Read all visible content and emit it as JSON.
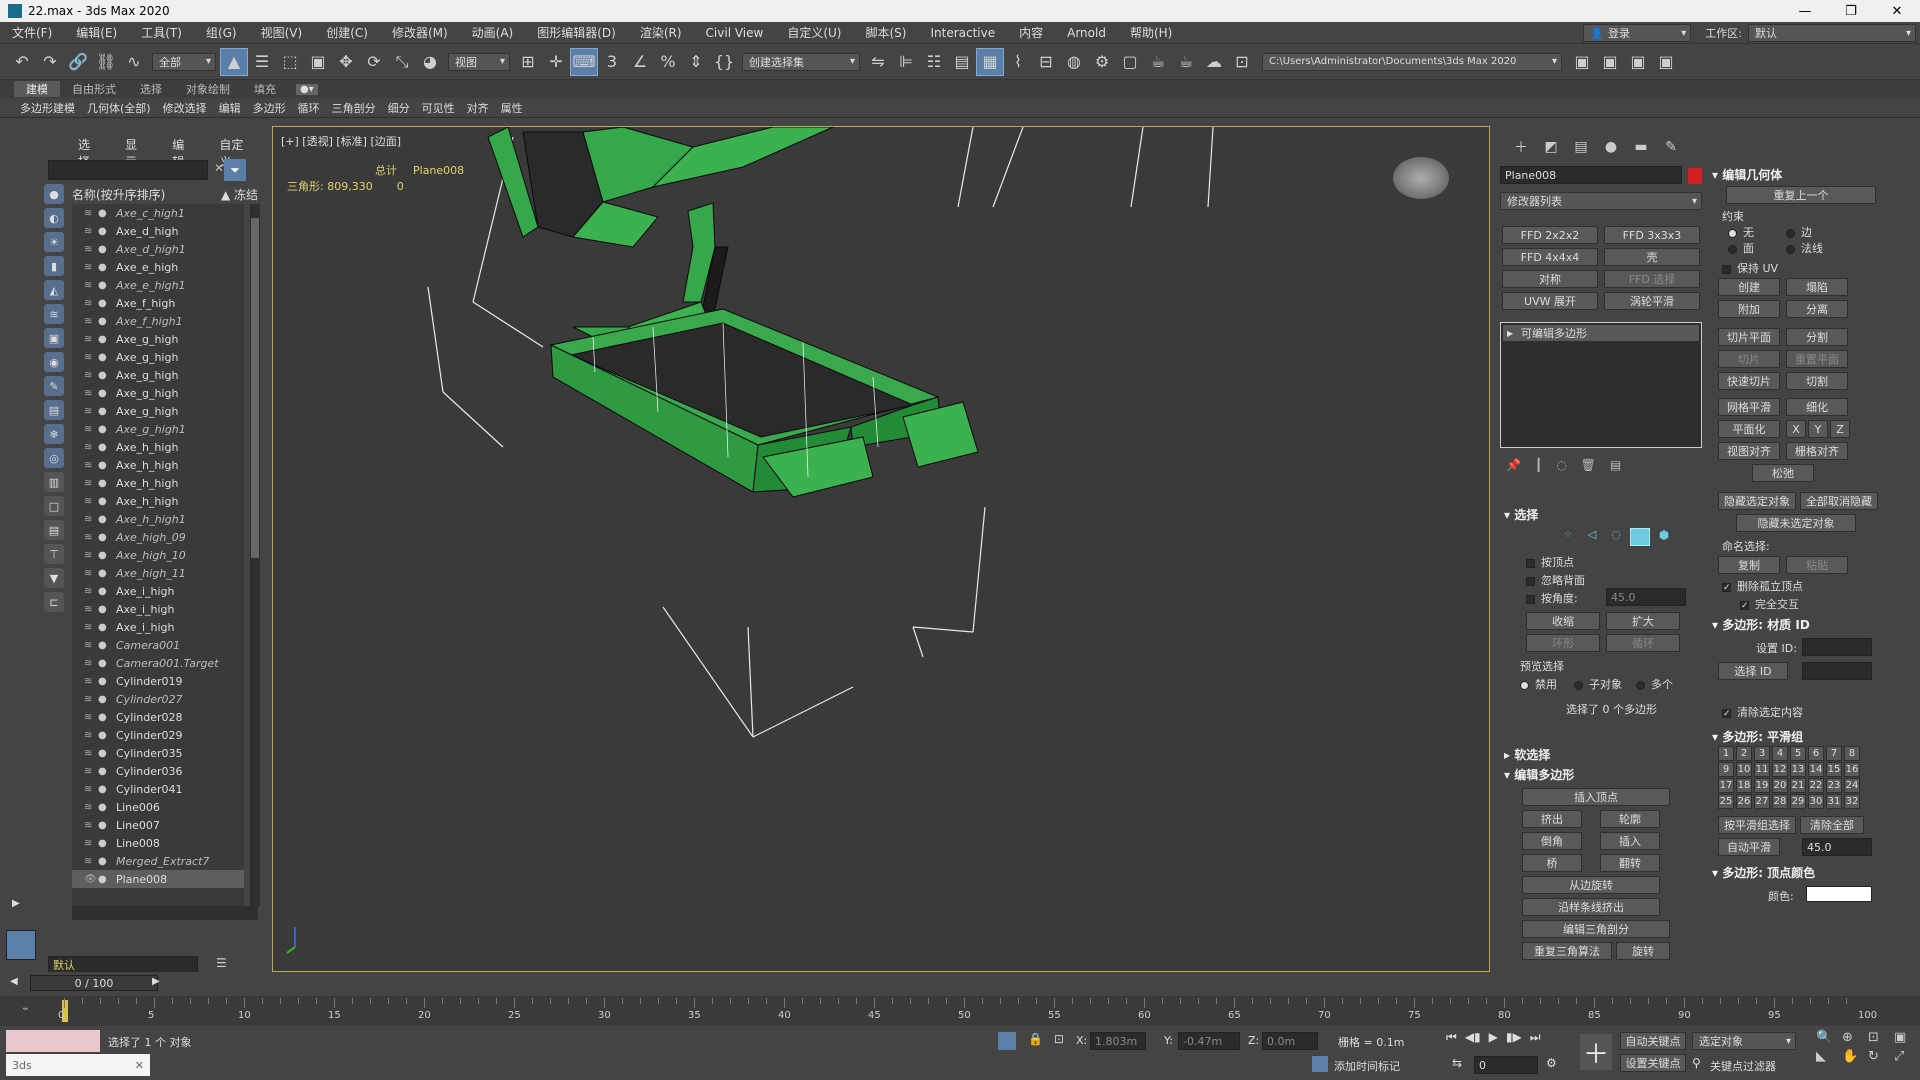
{
  "window": {
    "title": "22.max - 3ds Max 2020",
    "min": "—",
    "max": "❐",
    "close": "✕"
  },
  "menu": [
    "文件(F)",
    "编辑(E)",
    "工具(T)",
    "组(G)",
    "视图(V)",
    "创建(C)",
    "修改器(M)",
    "动画(A)",
    "图形编辑器(D)",
    "渲染(R)",
    "Civil View",
    "自定义(U)",
    "脚本(S)",
    "Interactive",
    "内容",
    "Arnold",
    "帮助(H)"
  ],
  "account": {
    "login": "登录",
    "workspace_label": "工作区:",
    "workspace_value": "默认"
  },
  "toolbar": {
    "filter": "全部",
    "ref_coord": "视图",
    "selection_set": "创建选择集",
    "path": "C:\\Users\\Administrator\\Documents\\3ds Max 2020"
  },
  "ribbon_tabs": [
    "建模",
    "自由形式",
    "选择",
    "对象绘制",
    "填充"
  ],
  "ribbon_items": [
    "多边形建模",
    "几何体(全部)",
    "修改选择",
    "编辑",
    "多边形",
    "循环",
    "三角剖分",
    "细分",
    "可见性",
    "对齐",
    "属性"
  ],
  "scene": {
    "tabs": [
      "选择",
      "显示",
      "编辑",
      "自定义"
    ],
    "col_name": "名称(按升序排序)",
    "col_freeze": "▲ 冻结",
    "items": [
      {
        "name": "Axe_c_high1",
        "italic": true
      },
      {
        "name": "Axe_d_high",
        "italic": false
      },
      {
        "name": "Axe_d_high1",
        "italic": true
      },
      {
        "name": "Axe_e_high",
        "italic": false
      },
      {
        "name": "Axe_e_high1",
        "italic": true
      },
      {
        "name": "Axe_f_high",
        "italic": false
      },
      {
        "name": "Axe_f_high1",
        "italic": true
      },
      {
        "name": "Axe_g_high",
        "italic": false
      },
      {
        "name": "Axe_g_high",
        "italic": false
      },
      {
        "name": "Axe_g_high",
        "italic": false
      },
      {
        "name": "Axe_g_high",
        "italic": false
      },
      {
        "name": "Axe_g_high",
        "italic": false
      },
      {
        "name": "Axe_g_high1",
        "italic": true
      },
      {
        "name": "Axe_h_high",
        "italic": false
      },
      {
        "name": "Axe_h_high",
        "italic": false
      },
      {
        "name": "Axe_h_high",
        "italic": false
      },
      {
        "name": "Axe_h_high",
        "italic": false
      },
      {
        "name": "Axe_h_high1",
        "italic": true
      },
      {
        "name": "Axe_high_09",
        "italic": true
      },
      {
        "name": "Axe_high_10",
        "italic": true
      },
      {
        "name": "Axe_high_11",
        "italic": true
      },
      {
        "name": "Axe_i_high",
        "italic": false
      },
      {
        "name": "Axe_i_high",
        "italic": false
      },
      {
        "name": "Axe_i_high",
        "italic": false
      },
      {
        "name": "Camera001",
        "italic": true
      },
      {
        "name": "Camera001.Target",
        "italic": true
      },
      {
        "name": "Cylinder019",
        "italic": false
      },
      {
        "name": "Cylinder027",
        "italic": true
      },
      {
        "name": "Cylinder028",
        "italic": false
      },
      {
        "name": "Cylinder029",
        "italic": false
      },
      {
        "name": "Cylinder035",
        "italic": false
      },
      {
        "name": "Cylinder036",
        "italic": false
      },
      {
        "name": "Cylinder041",
        "italic": false
      },
      {
        "name": "Line006",
        "italic": false
      },
      {
        "name": "Line007",
        "italic": false
      },
      {
        "name": "Line008",
        "italic": false
      },
      {
        "name": "Merged_Extract7",
        "italic": true
      },
      {
        "name": "Plane008",
        "italic": false,
        "selected": true
      }
    ],
    "layer": "默认"
  },
  "viewport": {
    "label": "[+] [透视] [标准] [边面]",
    "stat_total_label": "总计",
    "stat_obj": "Plane008",
    "stat_tri_label": "三角形:",
    "stat_tri_total": "809,330",
    "stat_tri_obj": "0"
  },
  "cmd": {
    "object_name": "Plane008",
    "modifier_list": "修改器列表",
    "mod_buttons": [
      "FFD 2x2x2",
      "FFD 3x3x3",
      "FFD 4x4x4",
      "壳",
      "对称",
      "FFD 选择",
      "UVW 展开",
      "涡轮平滑"
    ],
    "stack_item": "可编辑多边形",
    "sel_header": "选择",
    "by_vertex": "按顶点",
    "ignore_backface": "忽略背面",
    "by_angle": "按角度:",
    "angle_val": "45.0",
    "shrink": "收缩",
    "grow": "扩大",
    "ring": "环形",
    "loop": "循环",
    "preview_sel": "预览选择",
    "disabled": "禁用",
    "subobj": "子对象",
    "multi": "多个",
    "sel_info": "选择了 0 个多边形",
    "soft_sel": "软选择",
    "edit_poly": "编辑多边形",
    "insert_vertex": "插入顶点",
    "extrude": "挤出",
    "outline": "轮廓",
    "bevel": "倒角",
    "inset": "插入",
    "bridge": "桥",
    "flip": "翻转",
    "hinge": "从边旋转",
    "extrude_spline": "沿样条线挤出",
    "edit_tri": "编辑三角剖分",
    "retri": "重复三角算法",
    "turn": "旋转"
  },
  "geom": {
    "header": "编辑几何体",
    "repeat_last": "重复上一个",
    "constraints": "约束",
    "c_none": "无",
    "c_edge": "边",
    "c_face": "面",
    "c_normal": "法线",
    "preserve_uv": "保持 UV",
    "create": "创建",
    "collapse": "塌陷",
    "attach": "附加",
    "detach": "分离",
    "slice_plane": "切片平面",
    "split": "分割",
    "slice": "切片",
    "reset_plane": "重置平面",
    "quickslice": "快速切片",
    "cut": "切割",
    "meshsmooth": "网格平滑",
    "tessellate": "细化",
    "make_planar": "平面化",
    "x": "X",
    "y": "Y",
    "z": "Z",
    "view_align": "视图对齐",
    "grid_align": "栅格对齐",
    "relax": "松弛",
    "hide_sel": "隐藏选定对象",
    "unhide_all": "全部取消隐藏",
    "hide_unsel": "隐藏未选定对象",
    "named_sel": "命名选择:",
    "copy": "复制",
    "paste": "粘贴",
    "del_iso": "删除孤立顶点",
    "full_inter": "完全交互",
    "matid_header": "多边形: 材质 ID",
    "set_id": "设置 ID:",
    "select_id": "选择 ID",
    "clear_sel": "清除选定内容",
    "smooth_header": "多边形: 平滑组",
    "select_by_sg": "按平滑组选择",
    "clear_all": "清除全部",
    "auto_smooth": "自动平滑",
    "auto_val": "45.0",
    "vcolor_header": "多边形: 顶点颜色",
    "color": "颜色:",
    "groups": [
      "1",
      "2",
      "3",
      "4",
      "5",
      "6",
      "7",
      "8",
      "9",
      "10",
      "11",
      "12",
      "13",
      "14",
      "15",
      "16",
      "17",
      "18",
      "19",
      "20",
      "21",
      "22",
      "23",
      "24",
      "25",
      "26",
      "27",
      "28",
      "29",
      "30",
      "31",
      "32"
    ]
  },
  "timeline": {
    "frame": "0 / 100",
    "ticks": [
      "0",
      "5",
      "10",
      "15",
      "20",
      "25",
      "30",
      "35",
      "40",
      "45",
      "50",
      "55",
      "60",
      "65",
      "70",
      "75",
      "80",
      "85",
      "90",
      "95",
      "100"
    ]
  },
  "status": {
    "selected": "选择了 1 个 对象",
    "x_label": "X:",
    "x_val": "1.803m",
    "y_label": "Y:",
    "y_val": "-0.47m",
    "z_label": "Z:",
    "z_val": "0.0m",
    "grid": "栅格 = 0.1m",
    "add_tag": "添加时间标记",
    "auto_key": "自动关键点",
    "set_key": "设置关键点",
    "sel_obj": "选定对象",
    "key_filter": "关键点过滤器",
    "frame_field": "0"
  }
}
